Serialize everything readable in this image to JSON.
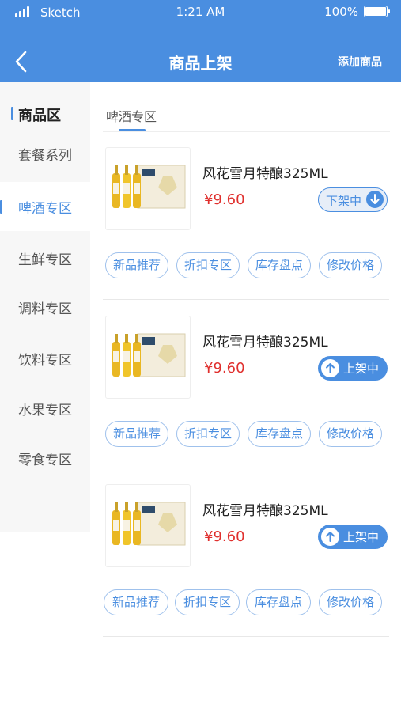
{
  "status_bar": {
    "carrier": "Sketch",
    "time": "1:21 AM",
    "battery": "100%"
  },
  "nav": {
    "title": "商品上架",
    "add_label": "添加商品"
  },
  "sidebar": {
    "heading": "商品区",
    "items": [
      {
        "label": "套餐系列",
        "active": false
      },
      {
        "label": "啤酒专区",
        "active": true
      },
      {
        "label": "生鲜专区",
        "active": false
      },
      {
        "label": "调料专区",
        "active": false
      },
      {
        "label": "饮料专区",
        "active": false
      },
      {
        "label": "水果专区",
        "active": false
      },
      {
        "label": "零食专区",
        "active": false
      }
    ]
  },
  "main": {
    "tab": "啤酒专区",
    "products": [
      {
        "name": "风花雪月特酿325ML",
        "price": "¥9.60",
        "status_label": "下架中",
        "status": "off"
      },
      {
        "name": "风花雪月特酿325ML",
        "price": "¥9.60",
        "status_label": "上架中",
        "status": "on"
      },
      {
        "name": "风花雪月特酿325ML",
        "price": "¥9.60",
        "status_label": "上架中",
        "status": "on"
      }
    ],
    "actions": [
      "新品推荐",
      "折扣专区",
      "库存盘点",
      "修改价格"
    ]
  },
  "colors": {
    "primary": "#4a8ee0",
    "price": "#e0302e",
    "sidebar_bg": "#f7f7f7"
  }
}
